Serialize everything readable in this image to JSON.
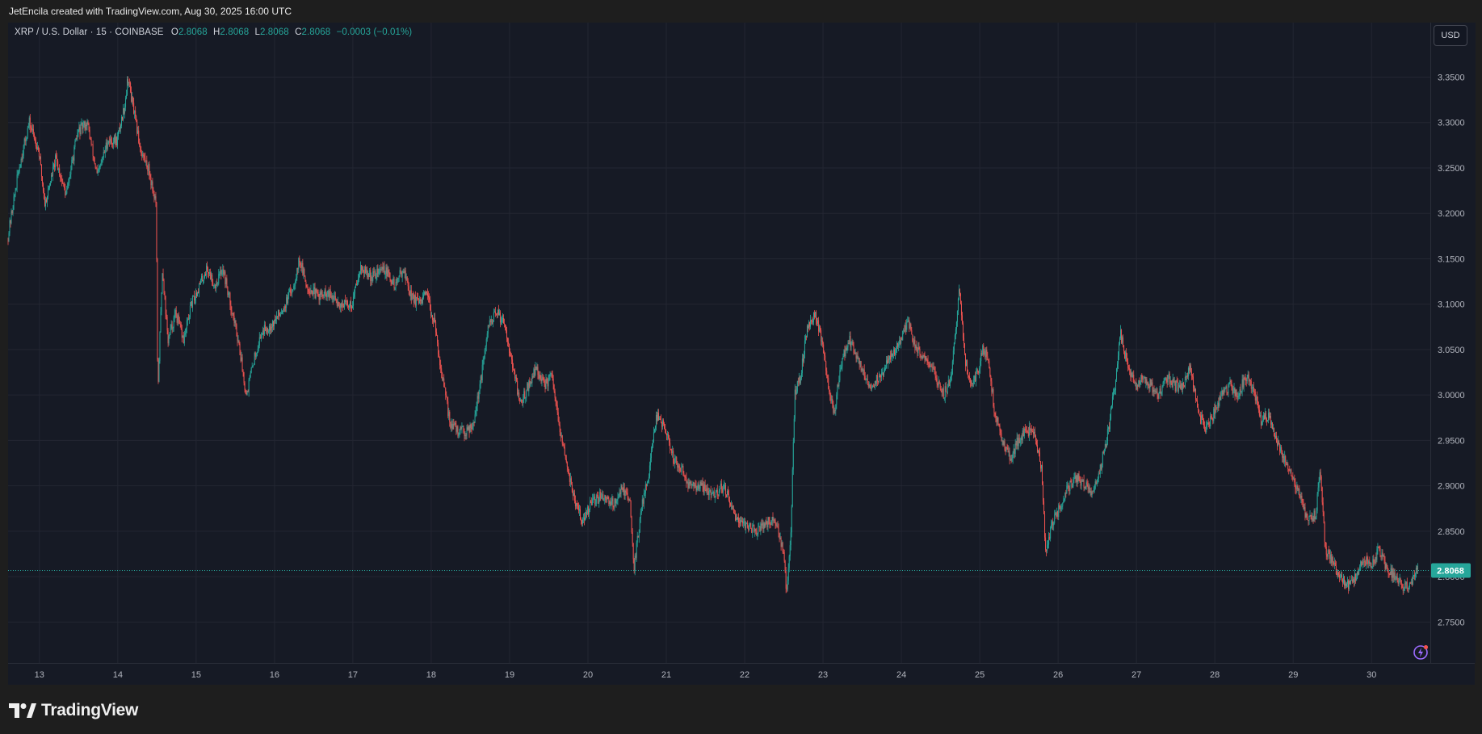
{
  "header": {
    "credit": "JetEncila created with TradingView.com, Aug 30, 2025 16:00 UTC"
  },
  "legend": {
    "symbol": "XRP / U.S. Dollar · 15 · COINBASE",
    "o_label": "O",
    "o_value": "2.8068",
    "h_label": "H",
    "h_value": "2.8068",
    "l_label": "L",
    "l_value": "2.8068",
    "c_label": "C",
    "c_value": "2.8068",
    "change": "−0.0003 (−0.01%)"
  },
  "currency_button": "USD",
  "footer": {
    "brand": "TradingView"
  },
  "colors": {
    "background": "#161a25",
    "grid": "#232632",
    "up": "#26a69a",
    "down": "#ef5350",
    "axis_text": "#b2b5be",
    "price_tag": "#26a69a"
  },
  "chart_data": {
    "type": "candlestick",
    "timeframe": "15",
    "symbol": "XRP / U.S. Dollar",
    "exchange": "COINBASE",
    "x_tick_labels": [
      "13",
      "14",
      "15",
      "16",
      "17",
      "18",
      "19",
      "20",
      "21",
      "22",
      "23",
      "24",
      "25",
      "26",
      "27",
      "28",
      "29",
      "30"
    ],
    "x_tick_days": [
      13,
      14,
      15,
      16,
      17,
      18,
      19,
      20,
      21,
      22,
      23,
      24,
      25,
      26,
      27,
      28,
      29,
      30
    ],
    "x_range_days": [
      12.6,
      30.75
    ],
    "y_ticks": [
      2.75,
      2.8,
      2.85,
      2.9,
      2.95,
      3.0,
      3.05,
      3.1,
      3.15,
      3.2,
      3.25,
      3.3,
      3.35
    ],
    "y_tick_labels": [
      "2.7500",
      "2.8000",
      "2.8500",
      "2.9000",
      "2.9500",
      "3.0000",
      "3.0500",
      "3.1000",
      "3.1500",
      "3.2000",
      "3.2500",
      "3.3000",
      "3.3500"
    ],
    "ylim": [
      2.705,
      3.41
    ],
    "last_price": 2.8068,
    "last_price_label": "2.8068",
    "grid": true,
    "price_path": [
      [
        12.6,
        3.17
      ],
      [
        12.75,
        3.25
      ],
      [
        12.88,
        3.3
      ],
      [
        13.0,
        3.27
      ],
      [
        13.08,
        3.21
      ],
      [
        13.22,
        3.26
      ],
      [
        13.35,
        3.22
      ],
      [
        13.5,
        3.29
      ],
      [
        13.62,
        3.3
      ],
      [
        13.75,
        3.24
      ],
      [
        13.88,
        3.28
      ],
      [
        14.0,
        3.28
      ],
      [
        14.1,
        3.32
      ],
      [
        14.14,
        3.35
      ],
      [
        14.22,
        3.31
      ],
      [
        14.3,
        3.27
      ],
      [
        14.4,
        3.25
      ],
      [
        14.5,
        3.21
      ],
      [
        14.52,
        3.0
      ],
      [
        14.58,
        3.14
      ],
      [
        14.65,
        3.06
      ],
      [
        14.75,
        3.09
      ],
      [
        14.85,
        3.06
      ],
      [
        14.95,
        3.1
      ],
      [
        15.05,
        3.12
      ],
      [
        15.15,
        3.14
      ],
      [
        15.25,
        3.12
      ],
      [
        15.35,
        3.14
      ],
      [
        15.45,
        3.1
      ],
      [
        15.55,
        3.06
      ],
      [
        15.65,
        3.0
      ],
      [
        15.75,
        3.04
      ],
      [
        15.85,
        3.07
      ],
      [
        16.0,
        3.08
      ],
      [
        16.15,
        3.1
      ],
      [
        16.25,
        3.12
      ],
      [
        16.33,
        3.15
      ],
      [
        16.42,
        3.12
      ],
      [
        16.55,
        3.11
      ],
      [
        16.7,
        3.11
      ],
      [
        16.85,
        3.1
      ],
      [
        17.0,
        3.1
      ],
      [
        17.1,
        3.14
      ],
      [
        17.25,
        3.13
      ],
      [
        17.4,
        3.14
      ],
      [
        17.55,
        3.12
      ],
      [
        17.65,
        3.14
      ],
      [
        17.75,
        3.11
      ],
      [
        17.85,
        3.1
      ],
      [
        17.95,
        3.11
      ],
      [
        18.05,
        3.08
      ],
      [
        18.15,
        3.02
      ],
      [
        18.25,
        2.97
      ],
      [
        18.35,
        2.96
      ],
      [
        18.45,
        2.96
      ],
      [
        18.55,
        2.97
      ],
      [
        18.65,
        3.02
      ],
      [
        18.75,
        3.08
      ],
      [
        18.85,
        3.09
      ],
      [
        18.95,
        3.08
      ],
      [
        19.05,
        3.03
      ],
      [
        19.15,
        2.99
      ],
      [
        19.25,
        3.01
      ],
      [
        19.35,
        3.03
      ],
      [
        19.45,
        3.01
      ],
      [
        19.55,
        3.02
      ],
      [
        19.65,
        2.96
      ],
      [
        19.75,
        2.92
      ],
      [
        19.85,
        2.88
      ],
      [
        19.95,
        2.86
      ],
      [
        20.05,
        2.88
      ],
      [
        20.2,
        2.89
      ],
      [
        20.35,
        2.88
      ],
      [
        20.45,
        2.9
      ],
      [
        20.55,
        2.88
      ],
      [
        20.6,
        2.81
      ],
      [
        20.7,
        2.88
      ],
      [
        20.8,
        2.92
      ],
      [
        20.85,
        2.96
      ],
      [
        20.9,
        2.98
      ],
      [
        21.0,
        2.96
      ],
      [
        21.1,
        2.93
      ],
      [
        21.2,
        2.92
      ],
      [
        21.3,
        2.9
      ],
      [
        21.45,
        2.9
      ],
      [
        21.6,
        2.89
      ],
      [
        21.75,
        2.9
      ],
      [
        21.85,
        2.87
      ],
      [
        22.0,
        2.86
      ],
      [
        22.15,
        2.85
      ],
      [
        22.3,
        2.86
      ],
      [
        22.4,
        2.86
      ],
      [
        22.5,
        2.83
      ],
      [
        22.55,
        2.78
      ],
      [
        22.6,
        2.85
      ],
      [
        22.65,
        3.0
      ],
      [
        22.72,
        3.02
      ],
      [
        22.8,
        3.07
      ],
      [
        22.9,
        3.09
      ],
      [
        23.0,
        3.06
      ],
      [
        23.1,
        3.0
      ],
      [
        23.15,
        2.98
      ],
      [
        23.25,
        3.04
      ],
      [
        23.35,
        3.06
      ],
      [
        23.45,
        3.04
      ],
      [
        23.6,
        3.01
      ],
      [
        23.75,
        3.02
      ],
      [
        23.85,
        3.04
      ],
      [
        24.0,
        3.06
      ],
      [
        24.1,
        3.08
      ],
      [
        24.2,
        3.05
      ],
      [
        24.35,
        3.04
      ],
      [
        24.45,
        3.02
      ],
      [
        24.55,
        3.0
      ],
      [
        24.65,
        3.02
      ],
      [
        24.75,
        3.12
      ],
      [
        24.82,
        3.04
      ],
      [
        24.9,
        3.01
      ],
      [
        25.0,
        3.03
      ],
      [
        25.05,
        3.05
      ],
      [
        25.12,
        3.04
      ],
      [
        25.2,
        2.98
      ],
      [
        25.3,
        2.95
      ],
      [
        25.4,
        2.93
      ],
      [
        25.5,
        2.95
      ],
      [
        25.6,
        2.96
      ],
      [
        25.7,
        2.96
      ],
      [
        25.8,
        2.92
      ],
      [
        25.85,
        2.83
      ],
      [
        25.95,
        2.86
      ],
      [
        26.05,
        2.88
      ],
      [
        26.15,
        2.9
      ],
      [
        26.25,
        2.91
      ],
      [
        26.35,
        2.9
      ],
      [
        26.45,
        2.89
      ],
      [
        26.55,
        2.92
      ],
      [
        26.65,
        2.96
      ],
      [
        26.75,
        3.02
      ],
      [
        26.8,
        3.07
      ],
      [
        26.9,
        3.03
      ],
      [
        27.0,
        3.01
      ],
      [
        27.1,
        3.02
      ],
      [
        27.2,
        3.01
      ],
      [
        27.3,
        3.0
      ],
      [
        27.4,
        3.02
      ],
      [
        27.5,
        3.01
      ],
      [
        27.6,
        3.01
      ],
      [
        27.7,
        3.03
      ],
      [
        27.8,
        2.98
      ],
      [
        27.9,
        2.96
      ],
      [
        28.0,
        2.98
      ],
      [
        28.1,
        3.0
      ],
      [
        28.2,
        3.01
      ],
      [
        28.3,
        3.0
      ],
      [
        28.4,
        3.02
      ],
      [
        28.5,
        3.01
      ],
      [
        28.6,
        2.97
      ],
      [
        28.7,
        2.98
      ],
      [
        28.8,
        2.95
      ],
      [
        28.9,
        2.93
      ],
      [
        29.0,
        2.91
      ],
      [
        29.1,
        2.89
      ],
      [
        29.2,
        2.86
      ],
      [
        29.3,
        2.87
      ],
      [
        29.35,
        2.92
      ],
      [
        29.42,
        2.83
      ],
      [
        29.5,
        2.82
      ],
      [
        29.6,
        2.8
      ],
      [
        29.7,
        2.79
      ],
      [
        29.8,
        2.8
      ],
      [
        29.9,
        2.82
      ],
      [
        30.0,
        2.81
      ],
      [
        30.1,
        2.83
      ],
      [
        30.2,
        2.81
      ],
      [
        30.3,
        2.8
      ],
      [
        30.4,
        2.79
      ],
      [
        30.5,
        2.79
      ],
      [
        30.6,
        2.81
      ]
    ]
  }
}
